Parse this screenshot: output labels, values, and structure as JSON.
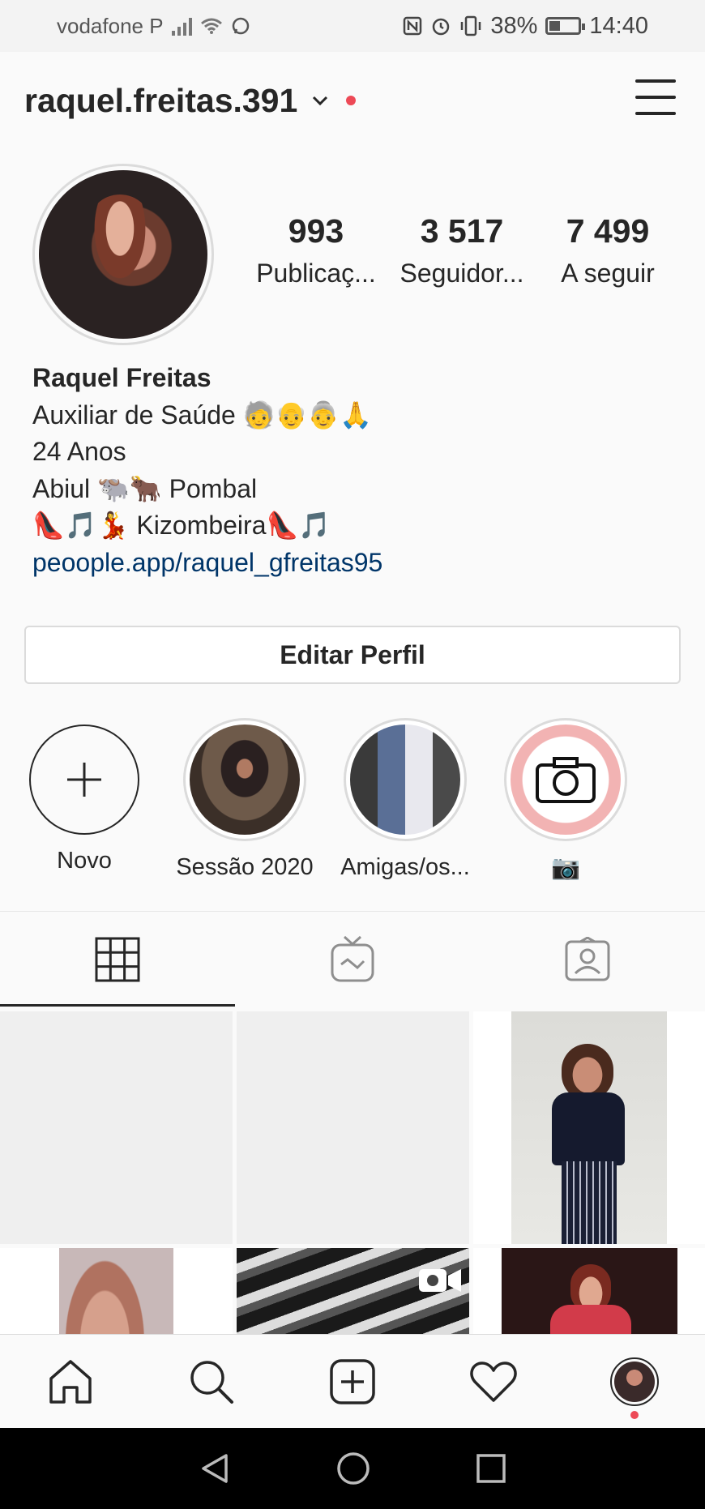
{
  "status_bar": {
    "carrier": "vodafone P",
    "battery": "38%",
    "time": "14:40"
  },
  "header": {
    "username": "raquel.freitas.391"
  },
  "profile": {
    "stats": [
      {
        "value": "993",
        "label": "Publicaç..."
      },
      {
        "value": "3 517",
        "label": "Seguidor..."
      },
      {
        "value": "7 499",
        "label": "A seguir"
      }
    ],
    "name": "Raquel Freitas",
    "bio_lines": [
      "Auxiliar de Saúde 🧓👴👵🙏",
      "24 Anos",
      "Abiul 🐃🐂 Pombal",
      "👠🎵💃 Kizombeira👠🎵"
    ],
    "link": "peoople.app/raquel_gfreitas95",
    "edit_button": "Editar Perfil"
  },
  "highlights": [
    {
      "label": "Novo"
    },
    {
      "label": "Sessão 2020"
    },
    {
      "label": "Amigas/os..."
    },
    {
      "label": "📷"
    }
  ],
  "tabs": [
    "grid",
    "igtv",
    "tagged"
  ],
  "icons": {
    "signal": "signal-icon",
    "wifi": "wifi-icon",
    "whatsapp": "whatsapp-icon",
    "nfc": "nfc-icon",
    "alarm": "alarm-icon",
    "vibrate": "vibrate-icon"
  }
}
